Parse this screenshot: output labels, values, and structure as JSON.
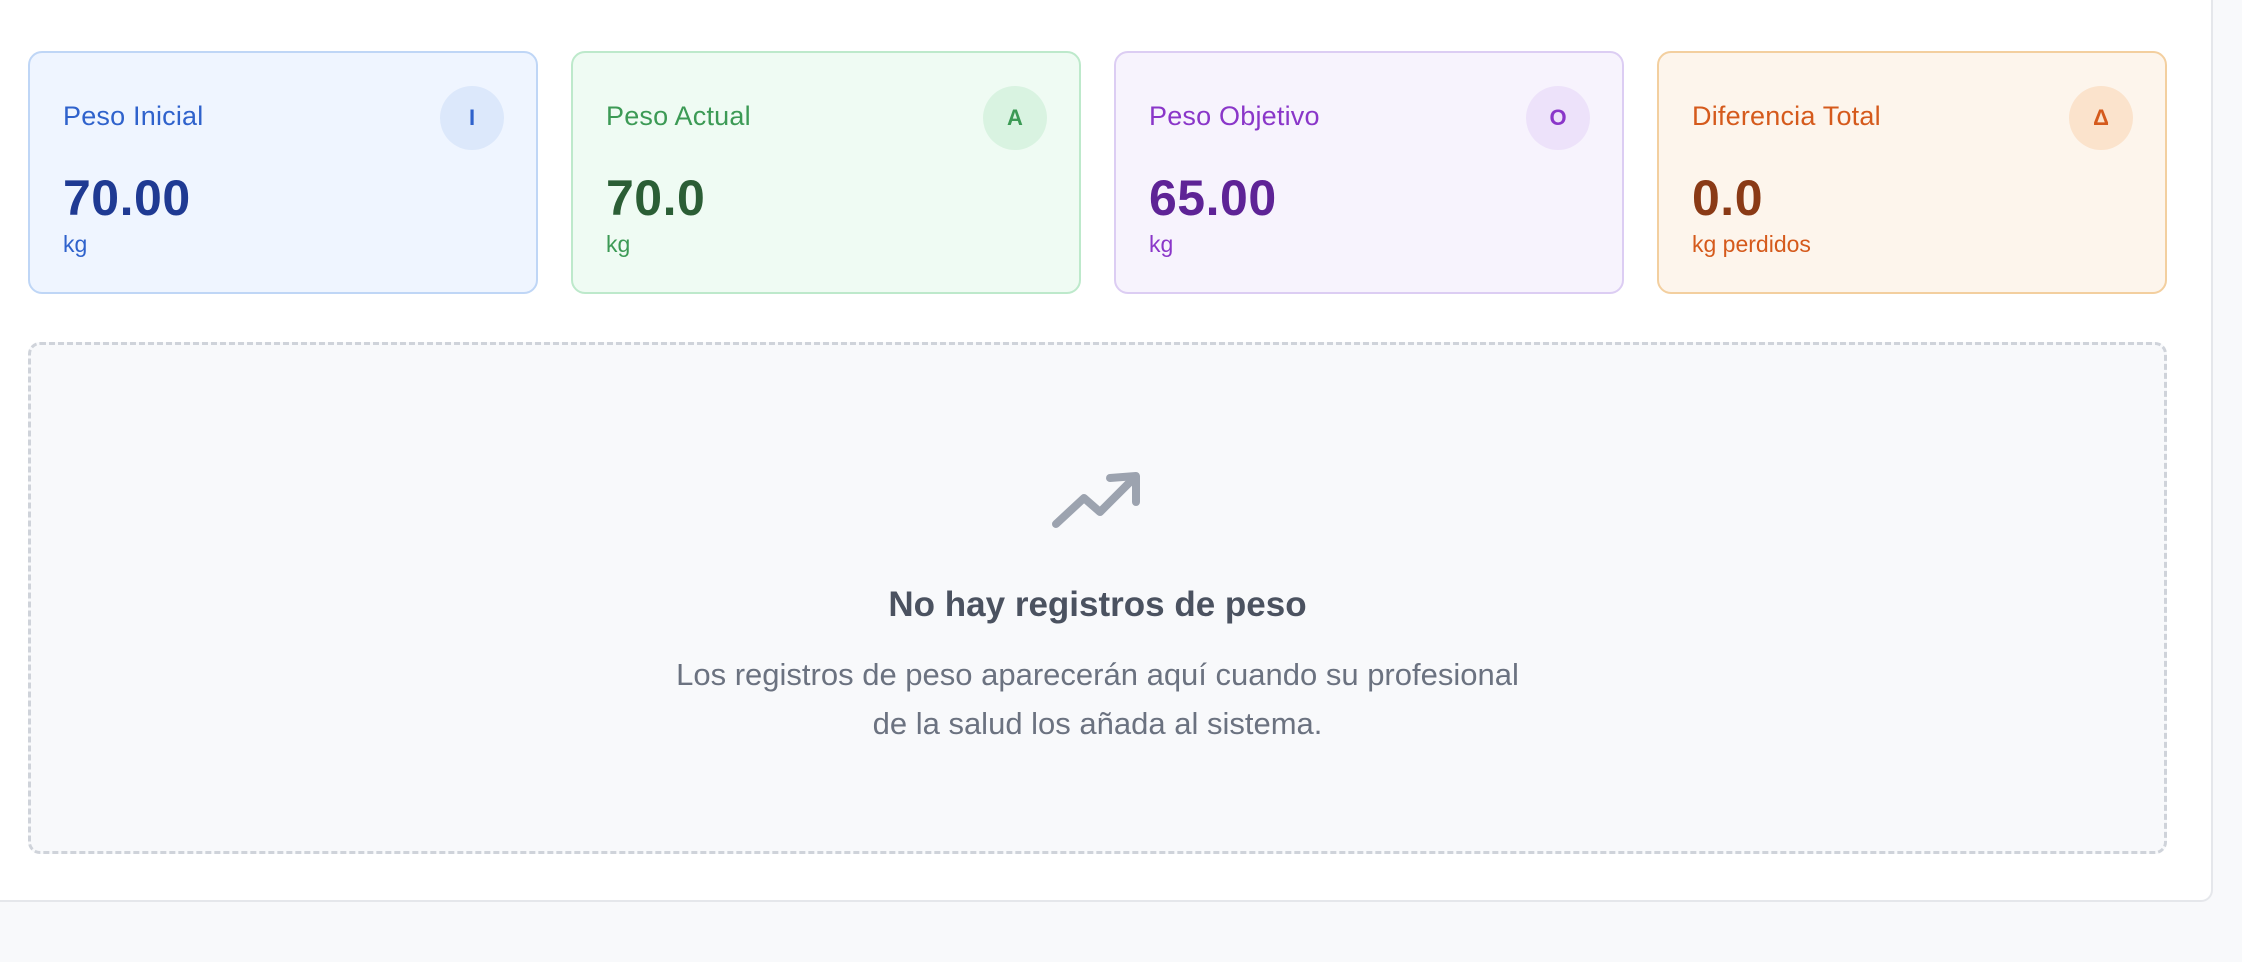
{
  "cards": [
    {
      "title": "Peso Inicial",
      "badge": "I",
      "value": "70.00",
      "unit": "kg"
    },
    {
      "title": "Peso Actual",
      "badge": "A",
      "value": "70.0",
      "unit": "kg"
    },
    {
      "title": "Peso Objetivo",
      "badge": "O",
      "value": "65.00",
      "unit": "kg"
    },
    {
      "title": "Diferencia Total",
      "badge": "Δ",
      "value": "0.0",
      "unit": "kg perdidos"
    }
  ],
  "empty_state": {
    "icon": "trending-up-icon",
    "heading": "No hay registros de peso",
    "description_line1": "Los registros de peso aparecerán aquí cuando su profesional",
    "description_line2": "de la salud los añada al sistema."
  },
  "colors": {
    "blue": "#2f62cc",
    "green": "#3c9a55",
    "purple": "#8a36c9",
    "orange": "#d55a1c"
  }
}
